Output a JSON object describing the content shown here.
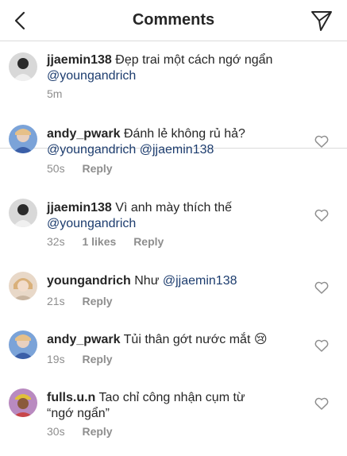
{
  "header": {
    "title": "Comments",
    "back_icon": "chevron-left-icon",
    "send_icon": "paper-plane-icon"
  },
  "colors": {
    "mention": "#1c3c6e",
    "meta": "#8e8e8e",
    "divider": "#dbdbdb"
  },
  "caption": {
    "username": "jjaemin138",
    "text": "Đẹp trai một cách ngớ ngẩn",
    "mention": "@youngandrich",
    "time": "5m"
  },
  "comments": [
    {
      "username": "andy_pwark",
      "text": "Đánh lẻ không rủ hả?",
      "mentions": "@youngandrich @jjaemin138",
      "time": "50s",
      "reply": "Reply"
    },
    {
      "username": "jjaemin138",
      "text": "Vì anh mày thích thế",
      "mentions": "@youngandrich",
      "time": "32s",
      "likes": "1 likes",
      "reply": "Reply"
    },
    {
      "username": "youngandrich",
      "text": "Như",
      "mentions": "@jjaemin138",
      "time": "21s",
      "reply": "Reply"
    },
    {
      "username": "andy_pwark",
      "text": "Tủi thân gớt nước mắt",
      "emoji": "😢",
      "time": "19s",
      "reply": "Reply"
    },
    {
      "username": "fulls.u.n",
      "text": "Tao chỉ công nhận cụm từ",
      "text_line2": "“ngớ ngẩn”",
      "time": "30s",
      "reply": "Reply"
    }
  ]
}
